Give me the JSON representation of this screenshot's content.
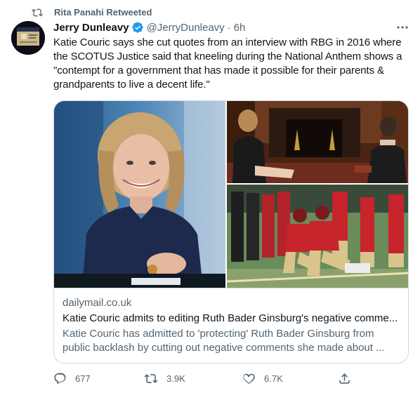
{
  "retweet": {
    "label": "Rita Panahi Retweeted",
    "icon": "retweet-icon"
  },
  "author": {
    "name": "Jerry Dunleavy",
    "handle": "@JerryDunleavy",
    "separator": "·",
    "time": "6h",
    "verified": true,
    "avatar_text": "Washington Examiner"
  },
  "tweet": {
    "text": "Katie Couric says she cut quotes from an interview with RBG in 2016 where the SCOTUS Justice said that kneeling during the National Anthem shows a \"contempt for a government that has made it possible for their parents & grandparents to live a decent life.\""
  },
  "link_card": {
    "domain": "dailymail.co.uk",
    "title": "Katie Couric admits to editing Ruth Bader Ginsburg's negative comme...",
    "description": "Katie Couric has admitted to 'protecting' Ruth Bader Ginsburg from public backlash by cutting out negative comments she made about ..."
  },
  "actions": {
    "reply_count": "677",
    "retweet_count": "3.9K",
    "like_count": "6.7K"
  },
  "colors": {
    "text_primary": "#0f1419",
    "text_secondary": "#536471",
    "verified_blue": "#1d9bf0",
    "border": "#cfd9de"
  }
}
